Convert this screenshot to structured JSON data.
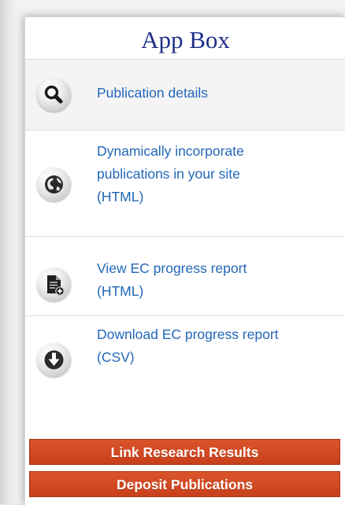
{
  "app_box": {
    "title": "App Box",
    "items": [
      {
        "label": "Publication details",
        "icon": "search-icon"
      },
      {
        "label": "Dynamically incorporate\npublications in your site\n(HTML)",
        "icon": "globe-icon"
      },
      {
        "label": "View EC progress report\n(HTML)",
        "icon": "document-add-icon"
      },
      {
        "label": "Download EC progress report\n(CSV)",
        "icon": "download-arrow-icon"
      }
    ],
    "buttons": {
      "link_results": "Link Research Results",
      "deposit": "Deposit Publications"
    }
  },
  "colors": {
    "title": "#1f2f86",
    "link": "#2367b8",
    "button": "#c8401b"
  }
}
